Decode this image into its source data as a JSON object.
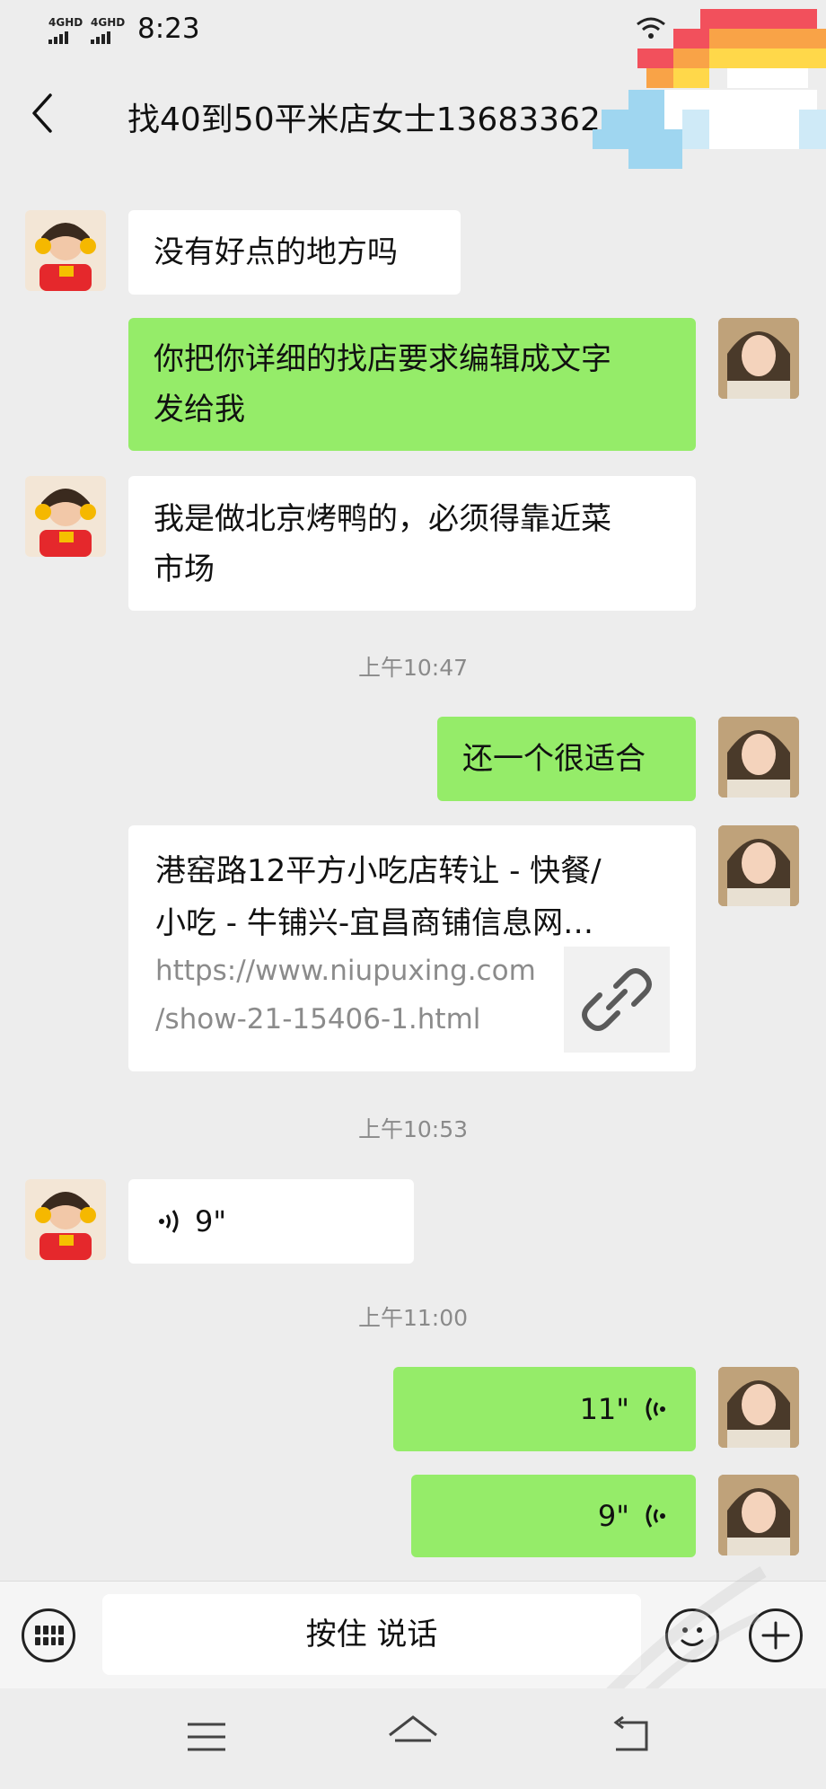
{
  "status": {
    "signal1": "4GHD",
    "signal2": "4GHD",
    "time": "8:23"
  },
  "header": {
    "title": "找40到50平米店女士13683362"
  },
  "messages": {
    "m1": "没有好点的地方吗",
    "m2a": "你把你详细的找店要求编辑成文字",
    "m2b": "发给我",
    "m3a": "我是做北京烤鸭的，必须得靠近菜",
    "m3b": "市场",
    "ts1": "上午10:47",
    "m4": "还一个很适合",
    "link_title_1": "港窑路12平方小吃店转让 - 快餐/",
    "link_title_2": "小吃 - 牛铺兴-宜昌商铺信息网…",
    "link_url_1": "https://www.niupuxing.com",
    "link_url_2": "/show-21-15406-1.html",
    "ts2": "上午10:53",
    "voice1": "9\"",
    "ts3": "上午11:00",
    "voice2": "11\"",
    "voice3": "9\""
  },
  "input": {
    "talk_label": "按住 说话"
  }
}
